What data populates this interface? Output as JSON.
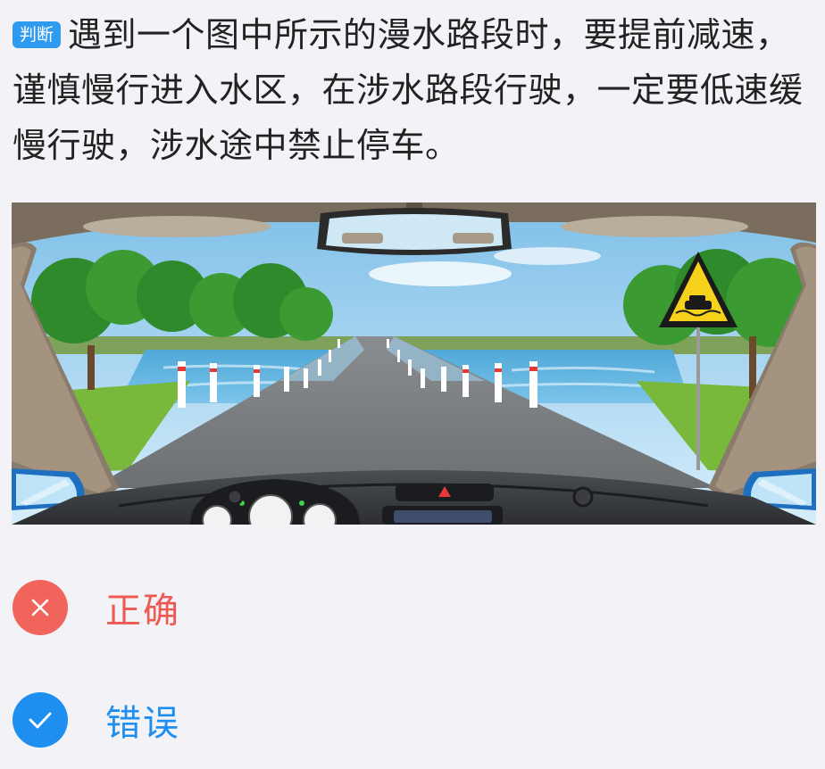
{
  "question": {
    "tag": "判断",
    "text": "遇到一个图中所示的漫水路段时，要提前减速，谨慎慢行进入水区，在涉水路段行驶，一定要低速缓慢行驶，涉水途中禁止停车。"
  },
  "options": [
    {
      "label": "正确",
      "state": "wrong",
      "icon": "close-icon",
      "color": "#f0645c"
    },
    {
      "label": "错误",
      "state": "correct",
      "icon": "check-icon",
      "color": "#1e8ff0"
    }
  ],
  "colors": {
    "tag_bg": "#2f9bf0",
    "wrong": "#f0645c",
    "correct": "#1e8ff0",
    "background": "#f3f2f7"
  }
}
